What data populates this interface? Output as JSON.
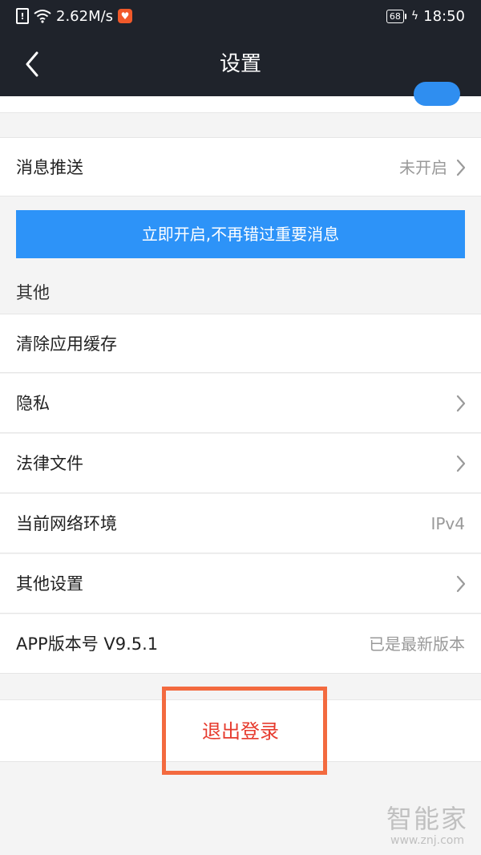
{
  "status_bar": {
    "speed": "2.62M/s",
    "battery": "68",
    "time": "18:50"
  },
  "nav": {
    "title": "设置"
  },
  "push": {
    "label": "消息推送",
    "value": "未开启",
    "enable_button": "立即开启,不再错过重要消息"
  },
  "section_other": {
    "header": "其他",
    "items": [
      {
        "label": "清除应用缓存",
        "value": ""
      },
      {
        "label": "隐私",
        "value": ""
      },
      {
        "label": "法律文件",
        "value": ""
      },
      {
        "label": "当前网络环境",
        "value": "IPv4"
      },
      {
        "label": "其他设置",
        "value": ""
      },
      {
        "label": "APP版本号 V9.5.1",
        "value": "已是最新版本"
      }
    ]
  },
  "logout": {
    "label": "退出登录"
  },
  "watermark": {
    "main": "智能家",
    "sub": "www.znj.com"
  },
  "colors": {
    "nav_background": "#1f232b",
    "enable_button": "#2d93f8",
    "logout_text": "#e63b2e",
    "highlight_border": "#f36a3f"
  },
  "icons": {
    "back": "chevron-left-icon",
    "chevron": "chevron-right-icon",
    "alert": "alert-icon",
    "wifi": "wifi-icon",
    "app": "app-badge-icon",
    "battery": "battery-icon",
    "charging": "charging-icon"
  }
}
